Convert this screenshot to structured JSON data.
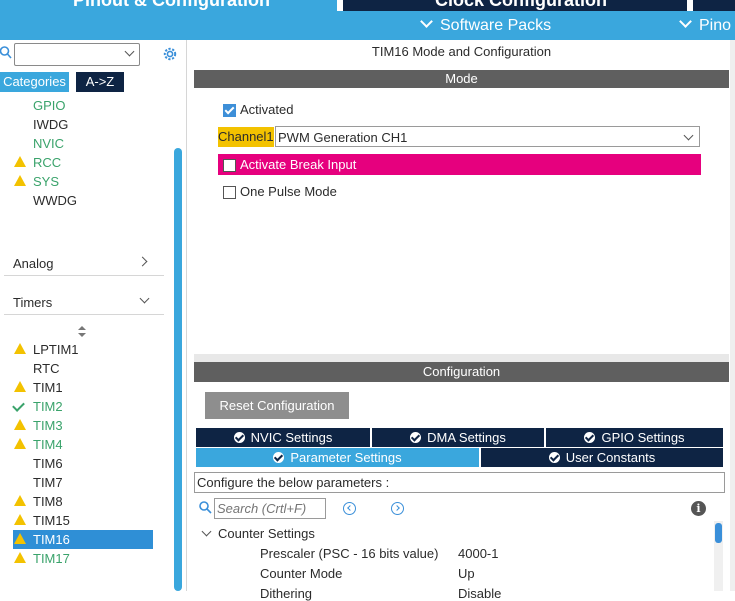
{
  "top_tabs": [
    "Pinout & Configuration",
    "Clock Configuration"
  ],
  "sub_links": [
    "Software Packs",
    "Pino"
  ],
  "left": {
    "search_value": "",
    "tab_categories": "Categories",
    "tab_az": "A->Z",
    "system_items": [
      {
        "label": "GPIO",
        "state": "ok"
      },
      {
        "label": "IWDG",
        "state": "none"
      },
      {
        "label": "NVIC",
        "state": "ok"
      },
      {
        "label": "RCC",
        "state": "warn"
      },
      {
        "label": "SYS",
        "state": "warn"
      },
      {
        "label": "WWDG",
        "state": "none"
      }
    ],
    "section_analog": "Analog",
    "section_timers": "Timers",
    "timer_items": [
      {
        "label": "LPTIM1",
        "state": "warn"
      },
      {
        "label": "RTC",
        "state": "none"
      },
      {
        "label": "TIM1",
        "state": "warn"
      },
      {
        "label": "TIM2",
        "state": "check"
      },
      {
        "label": "TIM3",
        "state": "warn"
      },
      {
        "label": "TIM4",
        "state": "warn"
      },
      {
        "label": "TIM6",
        "state": "none"
      },
      {
        "label": "TIM7",
        "state": "none"
      },
      {
        "label": "TIM8",
        "state": "warn"
      },
      {
        "label": "TIM15",
        "state": "warn"
      },
      {
        "label": "TIM16",
        "state": "selected"
      },
      {
        "label": "TIM17",
        "state": "warn"
      }
    ]
  },
  "main": {
    "title": "TIM16 Mode and Configuration",
    "mode_header": "Mode",
    "activated_label": "Activated",
    "channel_label": "Channel1",
    "channel_value": "PWM Generation CH1",
    "break_input_label": "Activate Break Input",
    "one_pulse_label": "One Pulse Mode",
    "config_header": "Configuration",
    "reset_button": "Reset Configuration",
    "tabs_row1": [
      "NVIC Settings",
      "DMA Settings",
      "GPIO Settings"
    ],
    "tabs_row2": [
      "Parameter Settings",
      "User Constants"
    ],
    "configure_text": "Configure the below parameters :",
    "search_placeholder": "Search (Crtl+F)",
    "group_label": "Counter Settings",
    "params": [
      {
        "name": "Prescaler (PSC - 16 bits value)",
        "value": "4000-1"
      },
      {
        "name": "Counter Mode",
        "value": "Up"
      },
      {
        "name": "Dithering",
        "value": "Disable"
      }
    ]
  },
  "colors": {
    "accent_blue": "#3aa7dd",
    "navy": "#0e2444",
    "warn_yellow": "#f3c200",
    "ok_green": "#3aa36b",
    "break_pink": "#e6007e",
    "selected_blue": "#2f8fd6"
  }
}
